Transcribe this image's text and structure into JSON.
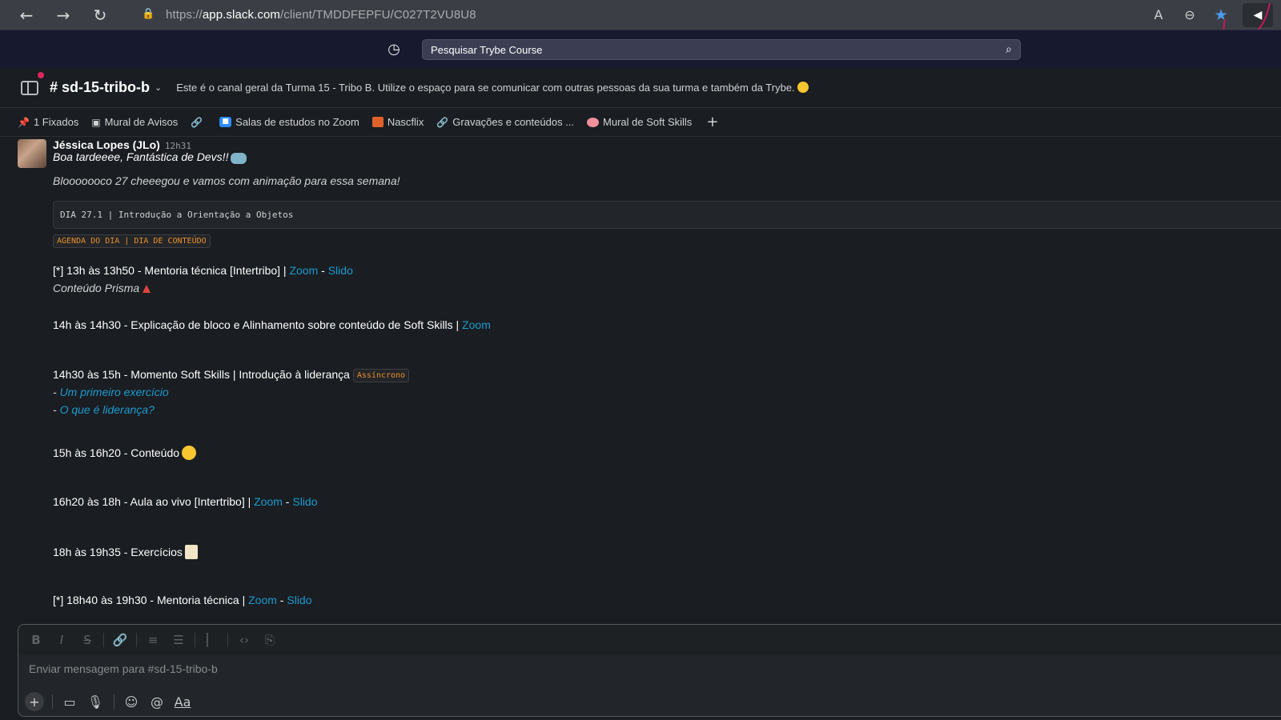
{
  "browser": {
    "url_scheme": "https://",
    "url_host": "app.slack.com",
    "url_path": "/client/TMDDFEPFU/C027T2VU8U8"
  },
  "slack": {
    "search_placeholder": "Pesquisar Trybe Course",
    "channel": {
      "name": "# sd-15-tribo-b",
      "topic": "Este é o canal geral da Turma 15 - Tribo B. Utilize o espaço para se comunicar com outras pessoas da sua turma e também da Trybe."
    },
    "bookmarks": [
      {
        "label": "1 Fixados"
      },
      {
        "label": "Mural de Avisos"
      },
      {
        "label": "Salas de estudos no Zoom"
      },
      {
        "label": "Nascflix"
      },
      {
        "label": "Gravações e conteúdos ..."
      },
      {
        "label": "Mural de Soft Skills"
      }
    ],
    "message": {
      "author": "Jéssica Lopes (JLo)",
      "time": "12h31",
      "greeting": "Boa tardeeee, Fantástica de Devs!!",
      "intro": "Blooooooco 27 cheeegou e vamos com animação para essa semana!",
      "code": "DIA 27.1 | Introdução a Orientação a Objetos",
      "agenda_tag": "AGENDA DO DIA | DIA DE CONTEÚDO",
      "items": {
        "i1": "[*] 13h às 13h50 - Mentoria técnica [Intertribo] | ",
        "i1_sub": "Conteúdo Prisma",
        "i2": "14h às 14h30 - Explicação de bloco e Alinhamento sobre conteúdo de Soft Skills | ",
        "i3": "14h30 às 15h - Momento Soft Skills | Introdução à liderança",
        "i3_tag": "Assíncrono",
        "i3_dash1": "- ",
        "i3_link1": "Um primeiro exercício",
        "i3_dash2": "- ",
        "i3_link2": "O que é liderança?",
        "i4": "15h às 16h20 - Conteúdo",
        "i5": "16h20 às 18h - Aula ao vivo [Intertribo]  | ",
        "i6": "18h às 19h35 - Exercícios",
        "i7": "[*] 18h40 às 19h30 - Mentoria técnica | "
      },
      "link_zoom": "Zoom",
      "link_slido": "Slido",
      "sep": " - "
    },
    "composer_placeholder": "Enviar mensagem para #sd-15-tribo-b",
    "format_buttons": [
      "B",
      "I",
      "S"
    ],
    "aa_label": "Aa"
  },
  "colors": {
    "link": "#1d9bd1",
    "topbar": "#171a2f",
    "background": "#1a1d21",
    "code_tag": "#e8912d"
  }
}
